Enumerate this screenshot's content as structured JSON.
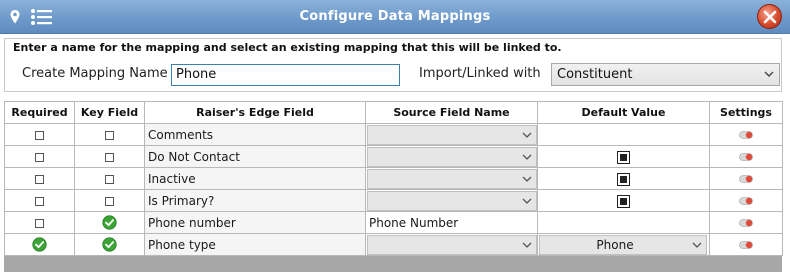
{
  "window": {
    "title": "Configure  Data Mappings",
    "title_bar_color": "#6f9acb",
    "icons": [
      "location-pin-icon",
      "list-icon",
      "close-icon"
    ]
  },
  "form": {
    "instructions": "Enter a name for the mapping and select an existing mapping that this will be linked to.",
    "name_label": "Create Mapping Name",
    "name_value": "Phone",
    "import_label": "Import/Linked with",
    "import_value": "Constituent"
  },
  "grid": {
    "headers": {
      "required": "Required",
      "key_field": "Key Field",
      "re_field": "Raiser's Edge Field",
      "source_field": "Source Field Name",
      "default_value": "Default Value",
      "settings": "Settings"
    },
    "rows": [
      {
        "field": "Comments",
        "required": false,
        "key": false,
        "source": "",
        "default_type": "none",
        "default": ""
      },
      {
        "field": "Do Not Contact",
        "required": false,
        "key": false,
        "source": "",
        "default_type": "checkbox",
        "default": ""
      },
      {
        "field": "Inactive",
        "required": false,
        "key": false,
        "source": "",
        "default_type": "checkbox",
        "default": ""
      },
      {
        "field": "Is Primary?",
        "required": false,
        "key": false,
        "source": "",
        "default_type": "checkbox",
        "default": ""
      },
      {
        "field": "Phone number",
        "required": false,
        "key": true,
        "source": "Phone Number",
        "default_type": "none",
        "default": ""
      },
      {
        "field": "Phone type",
        "required": true,
        "key": true,
        "source": "",
        "default_type": "select",
        "default": "Phone"
      }
    ]
  },
  "colors": {
    "accent_blue": "#3c7fb1",
    "check_green": "#3aa535",
    "close_red": "#d84b2c",
    "toggle_red": "#e04a3a"
  }
}
